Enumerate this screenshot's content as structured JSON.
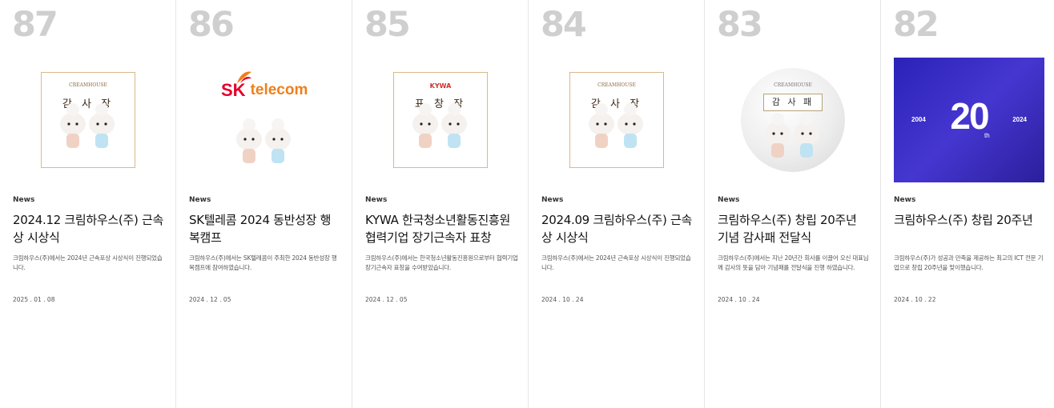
{
  "cards": [
    {
      "num": "87",
      "category": "News",
      "title": "2024.12 크림하우스(주) 근속상 시상식",
      "desc": "크림하우스(주)에서는 2024년 근속포상 시상식이 진행되었습니다.",
      "date": "2025 . 01 . 08",
      "image": {
        "brand": "CREAMHOUSE",
        "cert_title": "감 사 장"
      }
    },
    {
      "num": "86",
      "category": "News",
      "title": "SK텔레콤 2024 동반성장 행복캠프",
      "desc": "크림하우스(주)에서는 SK텔레콤이 주최한 2024 동반성장 행복캠프에 참여하였습니다.",
      "date": "2024 . 12 . 05",
      "image": {
        "logo_sk": "SK",
        "logo_telecom": "telecom"
      }
    },
    {
      "num": "85",
      "category": "News",
      "title": "KYWA 한국청소년활동진흥원 협력기업 장기근속자 표창",
      "desc": "크림하우스(주)에서는 한국청소년활동진흥원으로부터 협력기업 장기근속자 표창을 수여받았습니다.",
      "date": "2024 . 12 . 05",
      "image": {
        "brand": "KYWA",
        "cert_title": "표 창 장"
      }
    },
    {
      "num": "84",
      "category": "News",
      "title": "2024.09 크림하우스(주) 근속상 시상식",
      "desc": "크림하우스(주)에서는 2024년 근속포상 시상식이 진행되었습니다.",
      "date": "2024 . 10 . 24",
      "image": {
        "brand": "CREAMHOUSE",
        "cert_title": "감 사 장"
      }
    },
    {
      "num": "83",
      "category": "News",
      "title": "크림하우스(주) 창립 20주년 기념 감사패 전달식",
      "desc": "크림하우스(주)에서는 지난 20년간 회사를 이끌어 오신 대표님께 감사의 뜻을 담아 기념패를 전달식을 진행 하였습니다.",
      "date": "2024 . 10 . 24",
      "image": {
        "brand": "CREAMHOUSE",
        "cert_title": "감 사 패"
      }
    },
    {
      "num": "82",
      "category": "News",
      "title": "크림하우스(주) 창립 20주년",
      "desc": "크림하우스(주)가 성공과 만족을 제공하는 최고의 ICT 전문 기업으로 창립 20주년을 맞이했습니다.",
      "date": "2024 . 10 . 22",
      "image": {
        "year_start": "2004",
        "big": "20",
        "suffix": "th",
        "year_end": "2024"
      }
    }
  ],
  "colors": {
    "number": "#cfcfcf",
    "divider": "#e6e6e6",
    "sk_red": "#e4002b",
    "sk_orange": "#ef7f1a",
    "anniv_blue": "#3a2ec4"
  }
}
